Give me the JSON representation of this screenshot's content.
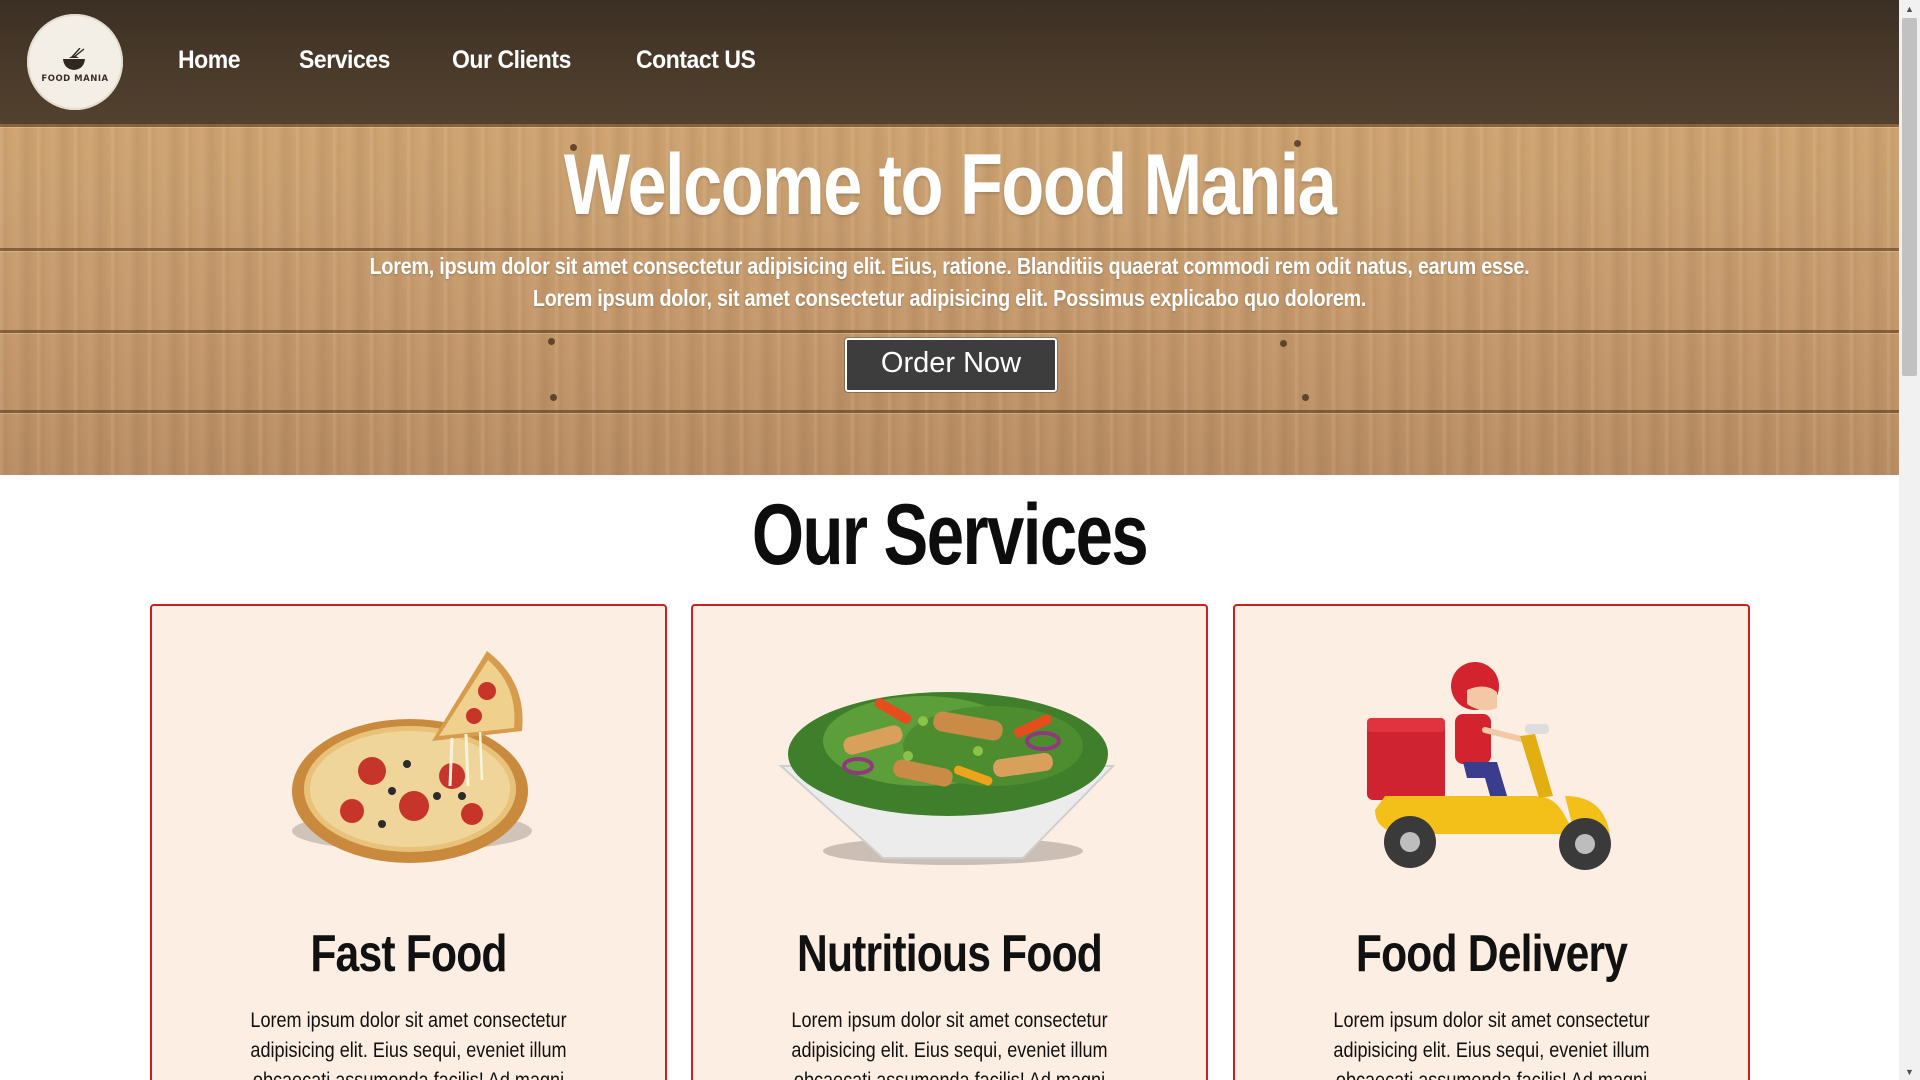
{
  "brand": {
    "logo_text": "FOOD MANIA"
  },
  "nav": {
    "items": [
      "Home",
      "Services",
      "Our Clients",
      "Contact US"
    ]
  },
  "hero": {
    "title": "Welcome to Food Mania",
    "line1": "Lorem, ipsum dolor sit amet consectetur adipisicing elit. Eius, ratione. Blanditiis quaerat commodi rem odit natus, earum esse.",
    "line2": "Lorem ipsum dolor, sit amet consectetur adipisicing elit. Possimus explicabo quo dolorem.",
    "cta_label": "Order Now"
  },
  "services": {
    "title": "Our Services",
    "cards": [
      {
        "image": "pizza-image",
        "title": "Fast Food",
        "text": "Lorem ipsum dolor sit amet consectetur adipisicing elit. Eius sequi, eveniet illum obcaecati assumenda facilis! Ad magni aspernatur molestiae harum dicta id"
      },
      {
        "image": "salad-bowl-image",
        "title": "Nutritious Food",
        "text": "Lorem ipsum dolor sit amet consectetur adipisicing elit. Eius sequi, eveniet illum obcaecati assumenda facilis! Ad magni aspernatur molestiae harum dicta id"
      },
      {
        "image": "delivery-scooter-image",
        "title": "Food Delivery",
        "text": "Lorem ipsum dolor sit amet consectetur adipisicing elit. Eius sequi, eveniet illum obcaecati assumenda facilis! Ad magni asperpatur molestiae harum dicta id"
      }
    ]
  },
  "colors": {
    "nav_bg": "#3b2f24",
    "wood": "#caa070",
    "button_bg": "#3d3d3d",
    "card_bg": "#fdeee3",
    "card_border": "#cc1f1f"
  }
}
